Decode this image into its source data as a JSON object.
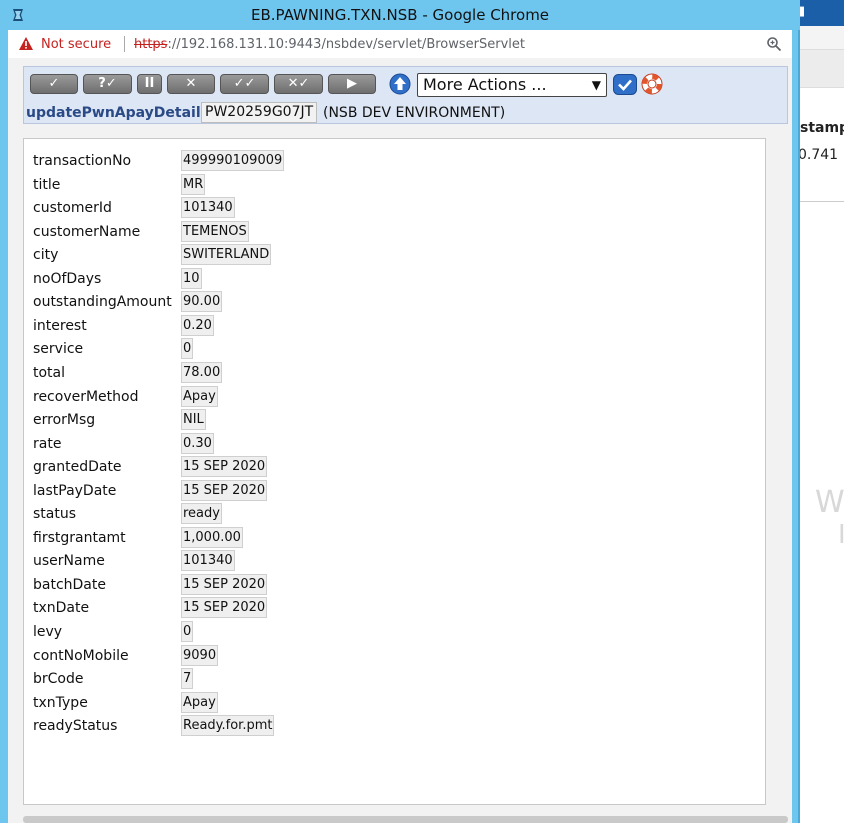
{
  "window": {
    "title": "EB.PAWNING.TXN.NSB - Google Chrome"
  },
  "address_bar": {
    "security_label": "Not secure",
    "url_scheme": "https",
    "url_rest": "://192.168.131.10:9443/nsbdev/servlet/BrowserServlet"
  },
  "toolbar": {
    "buttons": [
      {
        "label": "✓",
        "name": "commit-button"
      },
      {
        "label": "?✓",
        "name": "validate-button"
      },
      {
        "label": "II",
        "name": "hold-button"
      },
      {
        "label": "✕",
        "name": "delete-button"
      },
      {
        "label": "✓✓",
        "name": "authorise-button"
      },
      {
        "label": "✕✓",
        "name": "reverse-button"
      },
      {
        "label": "▶",
        "name": "next-button"
      }
    ],
    "more_actions": "More Actions ..."
  },
  "header": {
    "function_name": "updatePwnApayDetails",
    "record_id": "PW20259G07JT",
    "environment": "(NSB DEV ENVIRONMENT)"
  },
  "fields": [
    {
      "label": "transactionNo",
      "value": "499990109009"
    },
    {
      "label": "title",
      "value": "MR"
    },
    {
      "label": "customerId",
      "value": "101340"
    },
    {
      "label": "customerName",
      "value": "TEMENOS"
    },
    {
      "label": "city",
      "value": "SWITERLAND"
    },
    {
      "label": "noOfDays",
      "value": "10"
    },
    {
      "label": "outstandingAmount",
      "value": "90.00"
    },
    {
      "label": "interest",
      "value": "0.20"
    },
    {
      "label": "service",
      "value": "0"
    },
    {
      "label": "total",
      "value": "78.00"
    },
    {
      "label": "recoverMethod",
      "value": "Apay"
    },
    {
      "label": "errorMsg",
      "value": "NIL"
    },
    {
      "label": "rate",
      "value": "0.30"
    },
    {
      "label": "grantedDate",
      "value": "15 SEP 2020"
    },
    {
      "label": "lastPayDate",
      "value": "15 SEP 2020"
    },
    {
      "label": "status",
      "value": "ready"
    },
    {
      "label": "firstgrantamt",
      "value": "1,000.00"
    },
    {
      "label": "userName",
      "value": "101340"
    },
    {
      "label": "batchDate",
      "value": "15 SEP 2020"
    },
    {
      "label": "txnDate",
      "value": "15 SEP 2020"
    },
    {
      "label": "levy",
      "value": "0"
    },
    {
      "label": "contNoMobile",
      "value": "9090"
    },
    {
      "label": "brCode",
      "value": "7"
    },
    {
      "label": "txnType",
      "value": "Apay"
    },
    {
      "label": "readyStatus",
      "value": "Ready.for.pmt"
    }
  ],
  "background_window": {
    "column_header": "stamp",
    "cell_value": "0.741",
    "watermark_1": "W",
    "watermark_2": "I"
  },
  "colors": {
    "titlebar": "#6ec6ef",
    "function_name": "#2a4a86",
    "not_secure": "#c5221f"
  }
}
